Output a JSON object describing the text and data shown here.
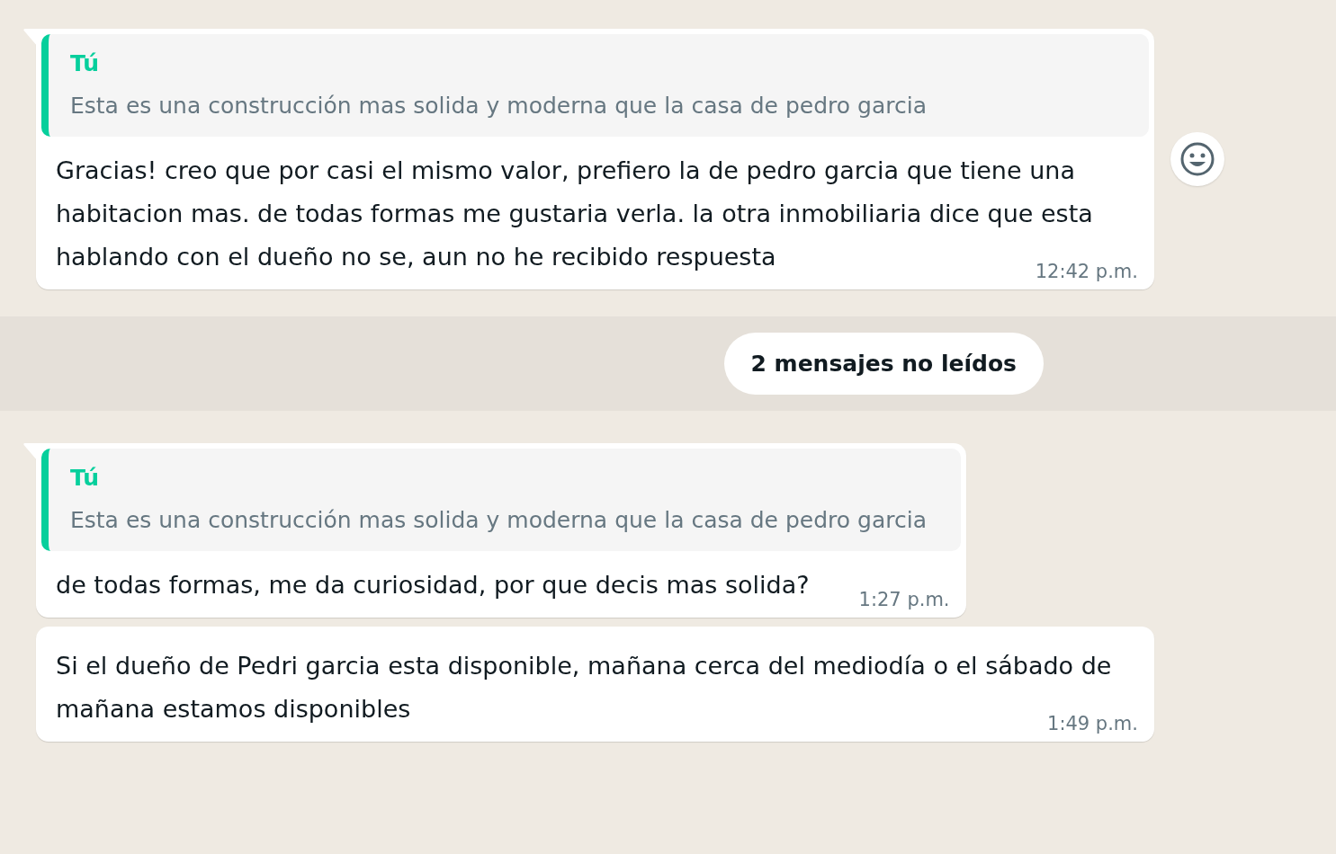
{
  "messages": [
    {
      "kind": "message",
      "tail": true,
      "react_button": true,
      "quote": {
        "author": "Tú",
        "text": "Esta es una construcción mas solida y moderna que la casa de pedro garcia"
      },
      "text": "Gracias! creo que por casi el mismo valor, prefiero la de pedro garcia que tiene una habitacion mas. de todas formas me gustaria verla. la otra inmobiliaria dice que esta hablando con el dueño no se, aun no he recibido respuesta",
      "time": "12:42 p.m."
    },
    {
      "kind": "unread_divider",
      "text": "2 mensajes no leídos"
    },
    {
      "kind": "message",
      "tail": true,
      "react_button": false,
      "quote": {
        "author": "Tú",
        "text": "Esta es una construcción mas solida y moderna que la casa de pedro garcia"
      },
      "text": "de todas formas, me da curiosidad, por que decis mas solida?",
      "time": "1:27 p.m."
    },
    {
      "kind": "message",
      "tail": false,
      "react_button": false,
      "text": "Si el dueño de Pedri garcia esta disponible, mañana cerca del mediodía o el sábado de mañana estamos disponibles",
      "time": "1:49 p.m."
    }
  ]
}
